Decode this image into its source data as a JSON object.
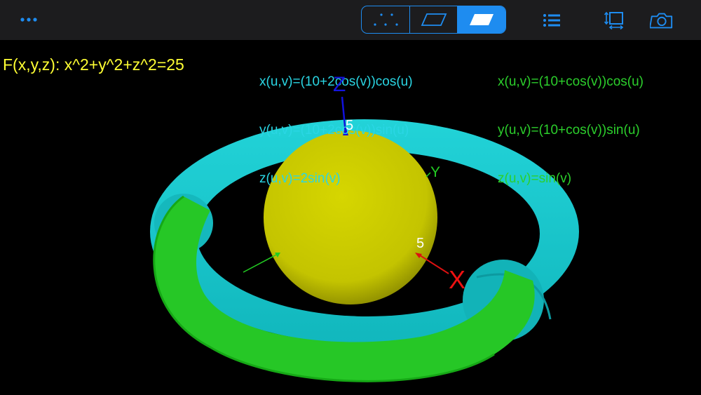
{
  "toolbar": {
    "more_icon": "more-horizontal-icon",
    "segments": [
      {
        "name": "points-mode",
        "icon": "dots-icon",
        "selected": false
      },
      {
        "name": "wireframe-mode",
        "icon": "parallelogram-outline-icon",
        "selected": false
      },
      {
        "name": "surface-mode",
        "icon": "parallelogram-filled-icon",
        "selected": true
      }
    ],
    "right_icons": [
      "list-icon",
      "resize-frame-icon",
      "camera-icon"
    ],
    "accent_color": "#1e8cf0"
  },
  "equations": {
    "implicit": "F(x,y,z): x^2+y^2+z^2=25",
    "param1": {
      "x": "x(u,v)=(10+2cos(v))cos(u)",
      "y": "y(u,v)=(10+2cos(v))sin(u)",
      "z": "z(u,v)=2sin(v)"
    },
    "param2": {
      "x": "x(u,v)=(10+cos(v))cos(u)",
      "y": "y(u,v)=(10+cos(v))sin(u)",
      "z": "z(u,v)=sin(v)"
    }
  },
  "axes": {
    "z_label": "Z",
    "y_label": "Y",
    "x_label": "X",
    "z_tick": "5",
    "x_tick": "5"
  },
  "colors": {
    "sphere": "#cfcf00",
    "torus_outer": "#19c9cf",
    "torus_inner": "#1fb81f",
    "implicit_text": "#ffff33",
    "param1_text": "#2ad6e4",
    "param2_text": "#2ccf2c"
  }
}
